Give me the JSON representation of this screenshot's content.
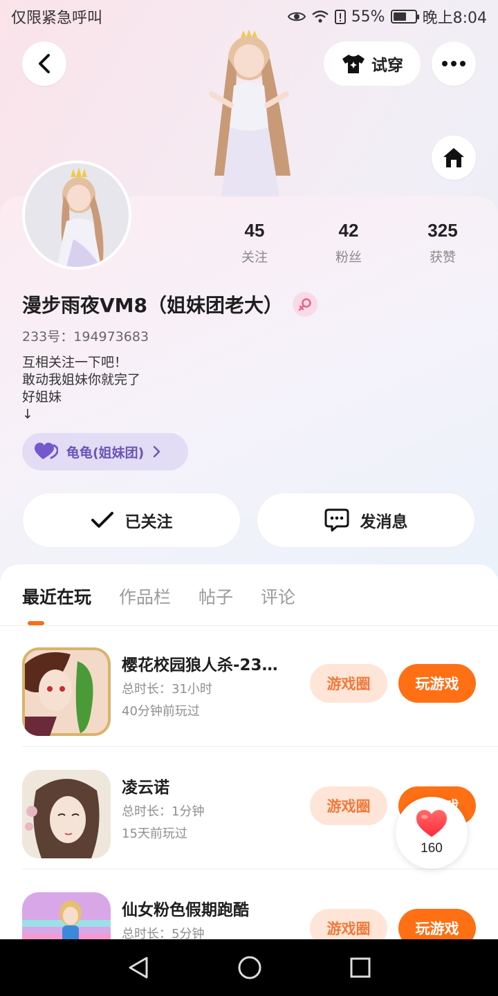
{
  "status_bar": {
    "left_text": "仅限紧急呼叫",
    "battery": "55%",
    "time": "晚上8:04"
  },
  "header": {
    "try_on_label": "试穿"
  },
  "profile": {
    "stats": [
      {
        "value": "45",
        "label": "关注"
      },
      {
        "value": "42",
        "label": "粉丝"
      },
      {
        "value": "325",
        "label": "获赞"
      }
    ],
    "nickname": "漫步雨夜VM8（姐妹团老大）",
    "user_id": "233号：194973683",
    "bio": [
      "互相关注一下吧！",
      "敢动我姐妹你就完了",
      "好姐妹",
      "↓"
    ],
    "group_chip": "龟龟(姐妹团)",
    "follow_button": "已关注",
    "message_button": "发消息"
  },
  "tabs": [
    {
      "label": "最近在玩",
      "active": true
    },
    {
      "label": "作品栏",
      "active": false
    },
    {
      "label": "帖子",
      "active": false
    },
    {
      "label": "评论",
      "active": false
    }
  ],
  "games": [
    {
      "title": "樱花校园狼人杀-233...",
      "duration": "总时长：31小时",
      "last_played": "40分钟前玩过",
      "circle_label": "游戏圈",
      "play_label": "玩游戏"
    },
    {
      "title": "凌云诺",
      "duration": "总时长：1分钟",
      "last_played": "15天前玩过",
      "circle_label": "游戏圈",
      "play_label": "玩游戏"
    },
    {
      "title": "仙女粉色假期跑酷",
      "duration": "总时长：5分钟",
      "last_played": "",
      "circle_label": "游戏圈",
      "play_label": "玩游戏"
    }
  ],
  "like_float": {
    "count": "160"
  },
  "icons": {
    "back": "chevron-left-icon",
    "tshirt": "tshirt-icon",
    "more": "more-dots-icon",
    "home": "home-icon",
    "female": "female-icon",
    "heart": "heart-icon",
    "check": "check-icon",
    "chat": "chat-bubble-icon"
  },
  "colors": {
    "accent_orange": "#ff6f14",
    "circle_btn_bg": "#ffe5d8",
    "group_chip_bg": "#e3dcf5",
    "group_chip_text": "#6a55b8"
  }
}
